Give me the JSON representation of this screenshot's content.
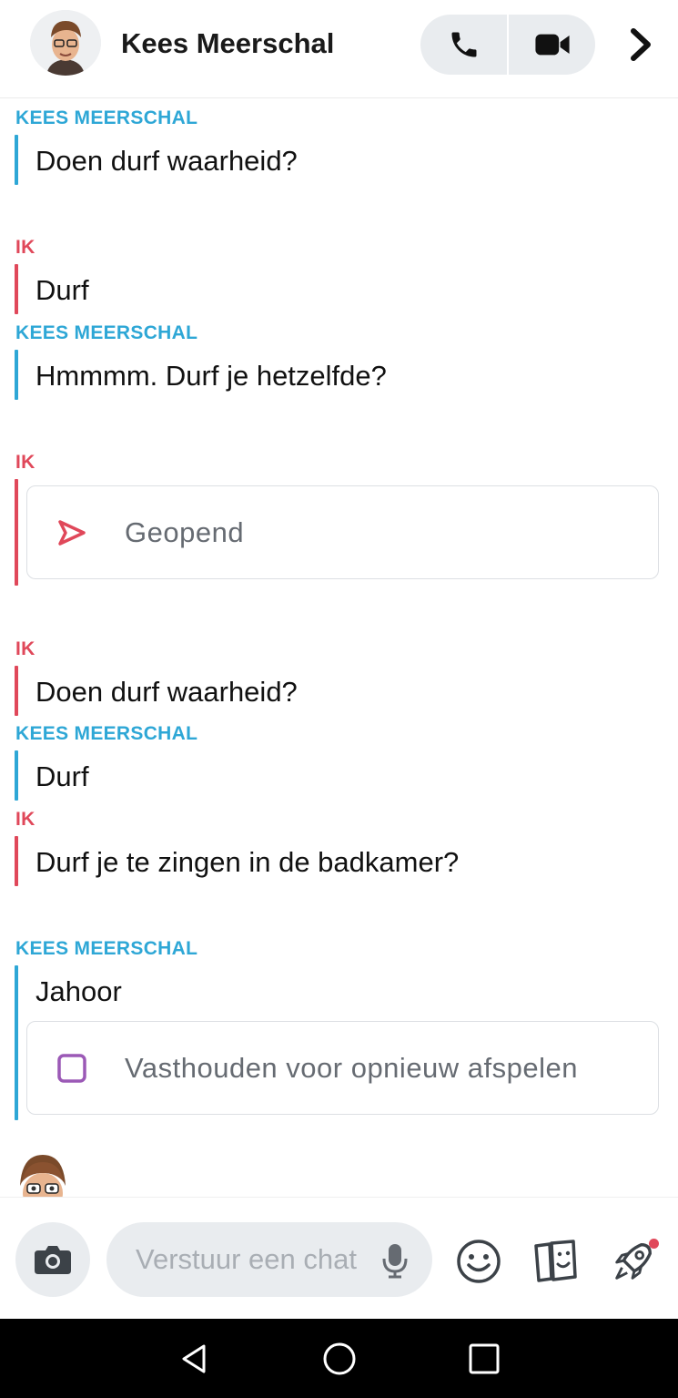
{
  "header": {
    "contact_name": "Kees Meerschal",
    "avatar_icon": "bitmoji-avatar",
    "call_icon": "phone-icon",
    "video_icon": "video-camera-icon",
    "more_icon": "chevron-right-icon"
  },
  "messages": [
    {
      "sender": "KEES MEERSCHAL",
      "text": "Doen durf waarheid?"
    },
    {
      "sender": "IK",
      "text": "Durf"
    },
    {
      "sender": "KEES MEERSCHAL",
      "text": "Hmmmm. Durf je hetzelfde?"
    },
    {
      "sender": "IK",
      "card": "Geopend",
      "card_icon": "sent-arrow-icon"
    },
    {
      "sender": "IK",
      "text": "Doen durf waarheid?"
    },
    {
      "sender": "KEES MEERSCHAL",
      "text": "Durf"
    },
    {
      "sender": "IK",
      "text": "Durf je te zingen in de badkamer?"
    },
    {
      "sender": "KEES MEERSCHAL",
      "text": "Jahoor",
      "card": "Vasthouden voor opnieuw afspelen",
      "card_icon": "unopened-square-icon"
    }
  ],
  "composer": {
    "placeholder": "Verstuur een chat",
    "camera_icon": "camera-icon",
    "mic_icon": "microphone-icon",
    "tools": [
      "emoji-icon",
      "stickers-icon",
      "rocket-icon"
    ]
  },
  "colors": {
    "kees": "#2ea7d6",
    "ik": "#e0485a",
    "unopened": "#9b59b6",
    "notification_dot": "#e0485a"
  },
  "system_nav": [
    "back-icon",
    "home-icon",
    "recents-icon"
  ]
}
